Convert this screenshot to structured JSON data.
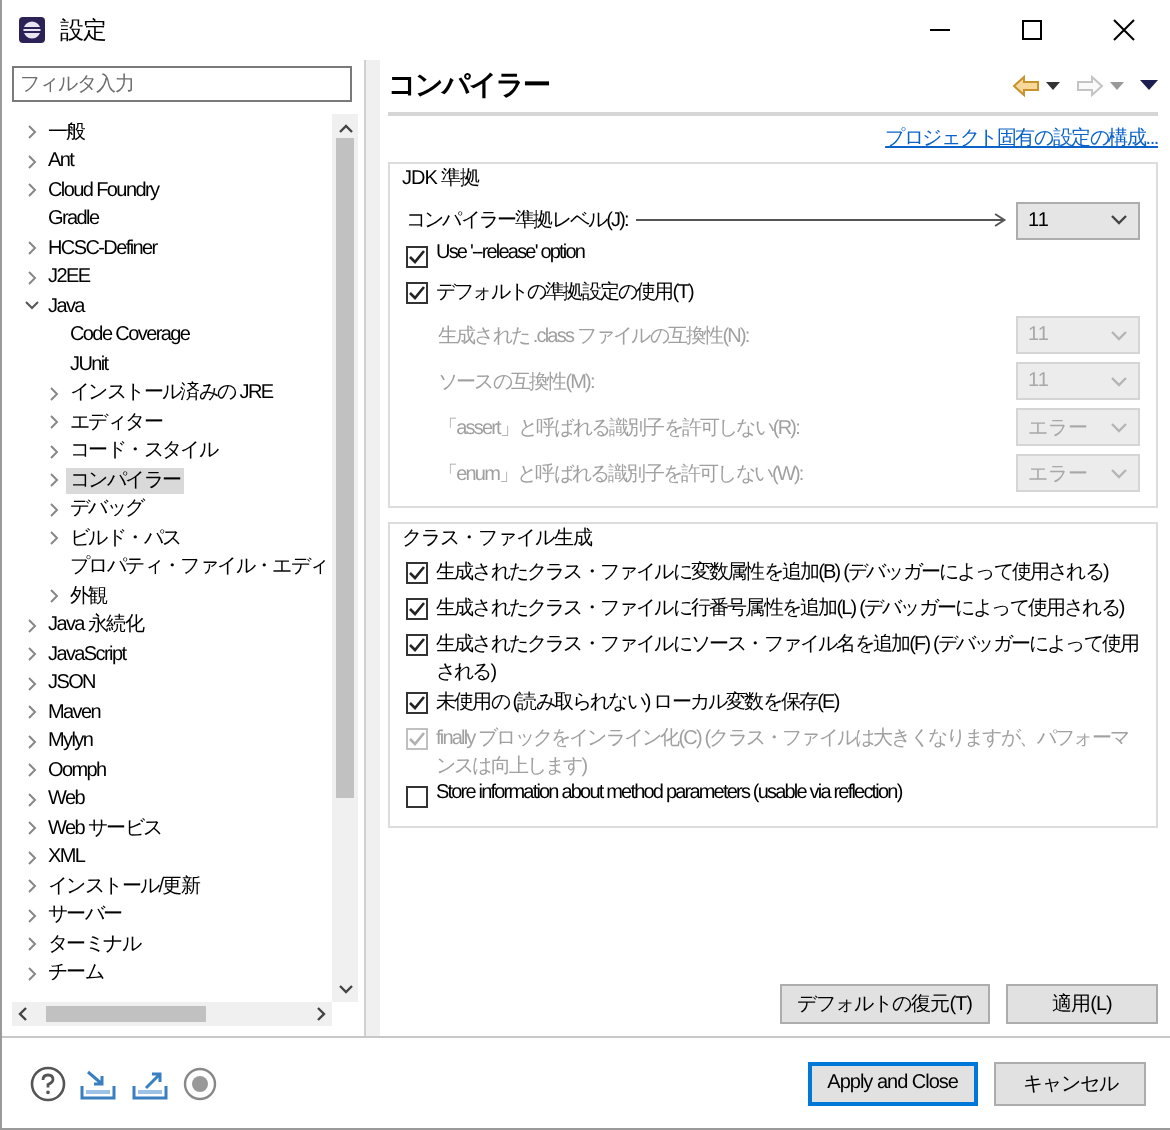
{
  "window": {
    "title": "設定"
  },
  "sidebar": {
    "filter": {
      "placeholder": "フィルタ入力"
    },
    "tree": [
      {
        "label": "一般",
        "kind": "folder",
        "expanded": false,
        "selected": false
      },
      {
        "label": "Ant",
        "kind": "folder",
        "expanded": false,
        "selected": false
      },
      {
        "label": "Cloud Foundry",
        "kind": "folder",
        "expanded": false,
        "selected": false
      },
      {
        "label": "Gradle",
        "kind": "leaf",
        "selected": false
      },
      {
        "label": "HCSC-Definer",
        "kind": "folder",
        "expanded": false,
        "selected": false
      },
      {
        "label": "J2EE",
        "kind": "folder",
        "expanded": false,
        "selected": false
      },
      {
        "label": "Java",
        "kind": "folder",
        "expanded": true,
        "selected": false,
        "children": [
          {
            "label": "Code Coverage",
            "kind": "leaf",
            "selected": false
          },
          {
            "label": "JUnit",
            "kind": "leaf",
            "selected": false
          },
          {
            "label": "インストール済みの JRE",
            "kind": "folder",
            "expanded": false,
            "selected": false
          },
          {
            "label": "エディター",
            "kind": "folder",
            "expanded": false,
            "selected": false
          },
          {
            "label": "コード・スタイル",
            "kind": "folder",
            "expanded": false,
            "selected": false
          },
          {
            "label": "コンパイラー",
            "kind": "folder",
            "expanded": false,
            "selected": true
          },
          {
            "label": "デバッグ",
            "kind": "folder",
            "expanded": false,
            "selected": false
          },
          {
            "label": "ビルド・パス",
            "kind": "folder",
            "expanded": false,
            "selected": false
          },
          {
            "label": "プロパティ・ファイル・エディ",
            "kind": "leaf",
            "selected": false
          },
          {
            "label": "外観",
            "kind": "folder",
            "expanded": false,
            "selected": false
          }
        ]
      },
      {
        "label": "Java 永続化",
        "kind": "folder",
        "expanded": false,
        "selected": false
      },
      {
        "label": "JavaScript",
        "kind": "folder",
        "expanded": false,
        "selected": false
      },
      {
        "label": "JSON",
        "kind": "folder",
        "expanded": false,
        "selected": false
      },
      {
        "label": "Maven",
        "kind": "folder",
        "expanded": false,
        "selected": false
      },
      {
        "label": "Mylyn",
        "kind": "folder",
        "expanded": false,
        "selected": false
      },
      {
        "label": "Oomph",
        "kind": "folder",
        "expanded": false,
        "selected": false
      },
      {
        "label": "Web",
        "kind": "folder",
        "expanded": false,
        "selected": false
      },
      {
        "label": "Web サービス",
        "kind": "folder",
        "expanded": false,
        "selected": false
      },
      {
        "label": "XML",
        "kind": "folder",
        "expanded": false,
        "selected": false
      },
      {
        "label": "インストール/更新",
        "kind": "folder",
        "expanded": false,
        "selected": false
      },
      {
        "label": "サーバー",
        "kind": "folder",
        "expanded": false,
        "selected": false
      },
      {
        "label": "ターミナル",
        "kind": "folder",
        "expanded": false,
        "selected": false
      },
      {
        "label": "チーム",
        "kind": "folder",
        "expanded": false,
        "selected": false
      }
    ]
  },
  "page": {
    "title": "コンパイラー",
    "link": "プロジェクト固有の設定の構成...",
    "jdk_group": {
      "title": "JDK 準拠",
      "compliance": {
        "label": "コンパイラー準拠レベル(J):",
        "value": "11"
      },
      "options": [
        {
          "label": "Use '--release' option",
          "checked": true
        },
        {
          "label": "デフォルトの準拠設定の使用(T)",
          "checked": true
        }
      ],
      "settings": [
        {
          "label": "生成された .class ファイルの互換性(N):",
          "value": "11",
          "disabled": true
        },
        {
          "label": "ソースの互換性(M):",
          "value": "11",
          "disabled": true
        },
        {
          "label": "「assert」と呼ばれる識別子を許可しない(R):",
          "value": "エラー",
          "disabled": true
        },
        {
          "label": "「enum」と呼ばれる識別子を許可しない(W):",
          "value": "エラー",
          "disabled": true
        }
      ]
    },
    "classfile_group": {
      "title": "クラス・ファイル生成",
      "options": [
        {
          "label": "生成されたクラス・ファイルに変数属性を追加(B) (デバッガーによって使用される)",
          "checked": true,
          "disabled": false
        },
        {
          "label": "生成されたクラス・ファイルに行番号属性を追加(L) (デバッガーによって使用される)",
          "checked": true,
          "disabled": false
        },
        {
          "label": "生成されたクラス・ファイルにソース・ファイル名を追加(F) (デバッガーによって使用される)",
          "checked": true,
          "disabled": false
        },
        {
          "label": "未使用の (読み取られない) ローカル変数を保存(E)",
          "checked": true,
          "disabled": false
        },
        {
          "label": "finally ブロックをインライン化(C) (クラス・ファイルは大きくなりますが、パフォーマンスは向上します)",
          "checked": true,
          "disabled": true
        },
        {
          "label": "Store information about method parameters (usable via reflection)",
          "checked": false,
          "disabled": false
        }
      ]
    },
    "buttons": [
      {
        "label": "デフォルトの復元(T)"
      },
      {
        "label": "適用(L)"
      }
    ]
  },
  "footer": {
    "buttons": [
      {
        "label": "Apply and Close",
        "default": true
      },
      {
        "label": "キャンセル",
        "default": false
      }
    ]
  }
}
